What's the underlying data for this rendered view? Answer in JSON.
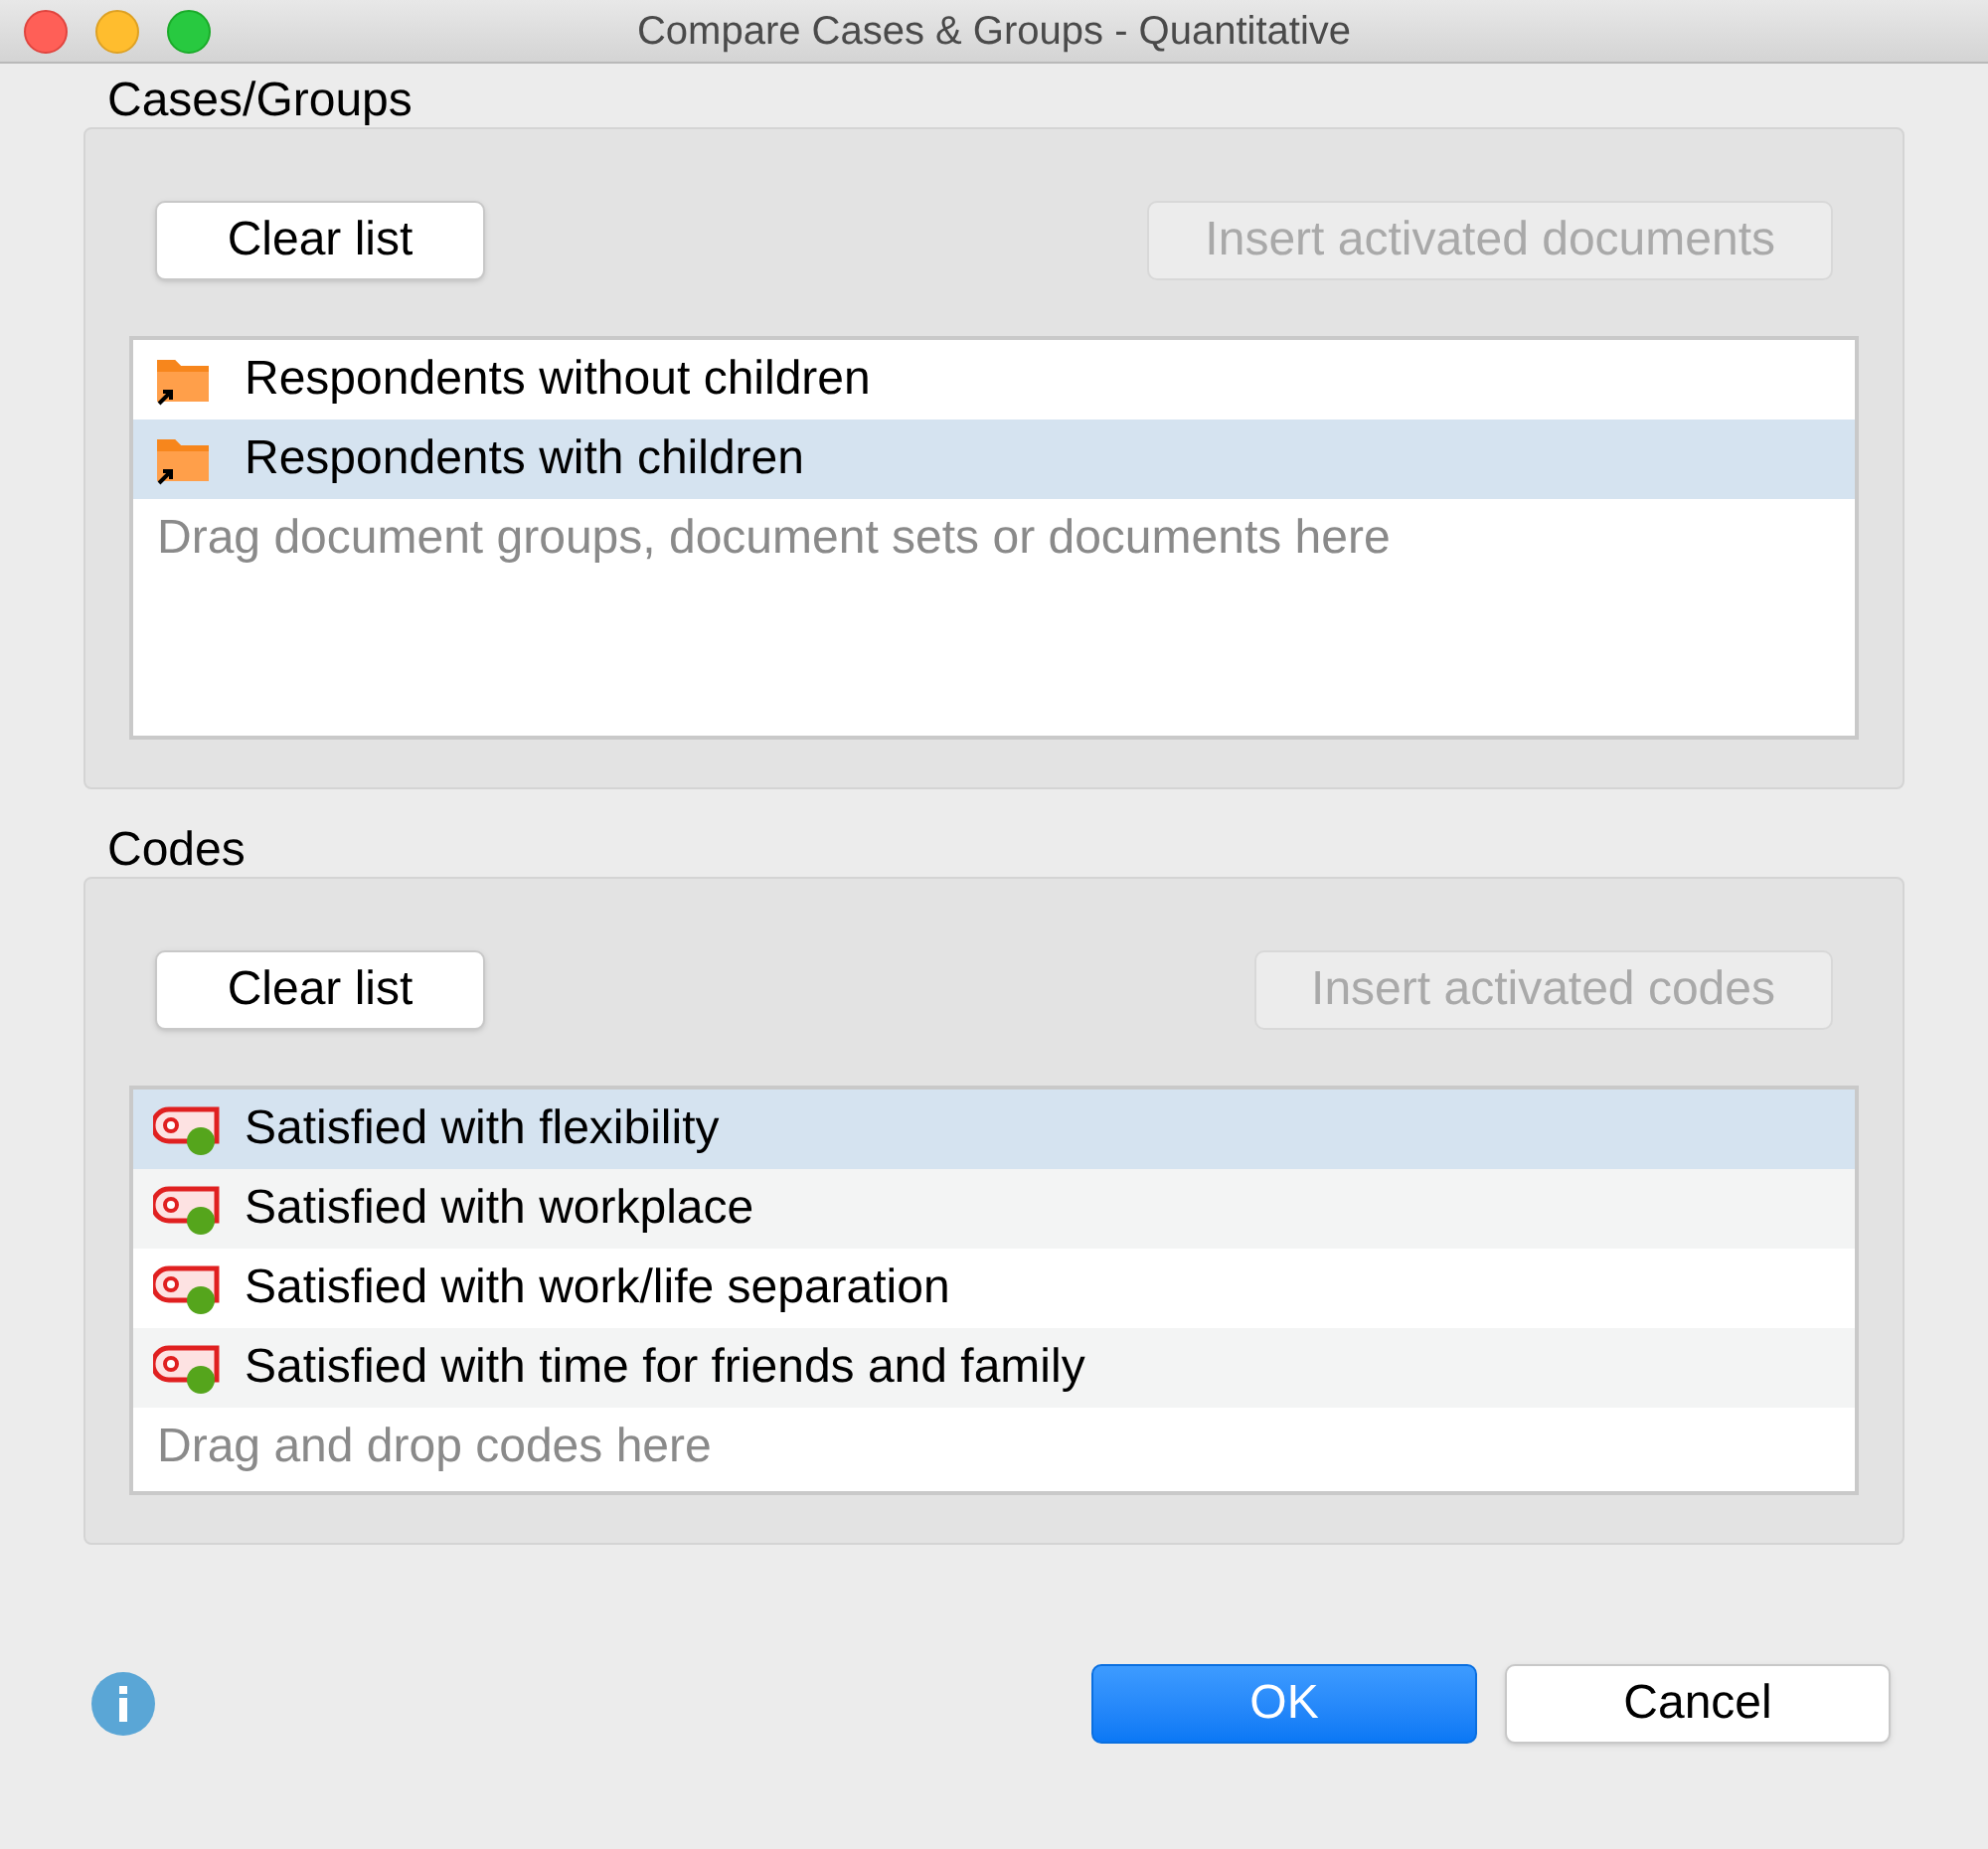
{
  "window": {
    "title": "Compare Cases & Groups - Quantitative"
  },
  "sections": [
    {
      "title": "Cases/Groups",
      "buttons": [
        {
          "label": "Clear list",
          "disabled": false
        },
        {
          "label": "Insert activated documents",
          "disabled": true
        }
      ],
      "items": [
        {
          "kind": "document-set",
          "label": "Respondents without children",
          "selected": false
        },
        {
          "kind": "document-set",
          "label": "Respondents with children",
          "selected": true
        }
      ],
      "placeholder": "Drag document groups, document sets or documents here"
    },
    {
      "title": "Codes",
      "buttons": [
        {
          "label": "Clear list",
          "disabled": false
        },
        {
          "label": "Insert activated codes",
          "disabled": true
        }
      ],
      "items": [
        {
          "kind": "code",
          "label": "Satisfied with flexibility",
          "selected": true
        },
        {
          "kind": "code",
          "label": "Satisfied with workplace",
          "selected": false
        },
        {
          "kind": "code",
          "label": "Satisfied with work/life separation",
          "selected": false
        },
        {
          "kind": "code",
          "label": "Satisfied with time for friends and family",
          "selected": false
        }
      ],
      "placeholder": "Drag and drop codes here"
    }
  ],
  "footer_buttons": [
    {
      "label": "OK",
      "default": true
    },
    {
      "label": "Cancel",
      "default": false
    }
  ]
}
